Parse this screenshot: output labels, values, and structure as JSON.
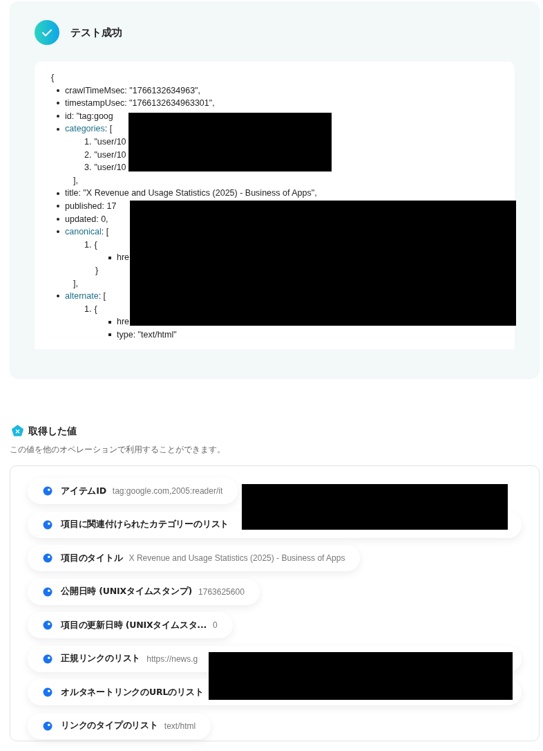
{
  "test_result": {
    "title": "テスト成功",
    "code_view": {
      "open": "{",
      "items": [
        {
          "kind": "field",
          "text": "crawlTimeMsec: \"1766132634963\","
        },
        {
          "kind": "field",
          "text": "timestampUsec: \"1766132634963301\","
        },
        {
          "kind": "field",
          "text": "id: \"tag:goog"
        },
        {
          "kind": "list",
          "key": "categories",
          "after": ": [",
          "close": "],",
          "children": [
            {
              "number": "1.",
              "text": "\"user/10"
            },
            {
              "number": "2.",
              "text": "\"user/10"
            },
            {
              "number": "3.",
              "text": "\"user/10"
            }
          ]
        },
        {
          "kind": "field",
          "text": "title: \"X Revenue and Usage Statistics (2025) - Business of Apps\","
        },
        {
          "kind": "field",
          "text": "published: 17"
        },
        {
          "kind": "field",
          "text": "updated: 0,"
        },
        {
          "kind": "list",
          "key": "canonical",
          "after": ": [",
          "close": "],",
          "children": [
            {
              "number": "1.",
              "text": "{",
              "close": "}",
              "children": [
                {
                  "text": "hre"
                }
              ]
            }
          ]
        },
        {
          "kind": "list",
          "key": "alternate",
          "after": ": [",
          "children": [
            {
              "number": "1.",
              "text": "{",
              "children": [
                {
                  "text": "hre"
                },
                {
                  "text": "type: \"text/html\""
                }
              ]
            }
          ]
        }
      ]
    }
  },
  "values_section": {
    "title": "取得した値",
    "description": "この値を他のオペレーションで利用することができます。",
    "items": [
      {
        "label": "アイテムID",
        "value": "tag:google.com,2005:reader/it",
        "redacted": false
      },
      {
        "label": "項目に関連付けられたカテゴリーのリスト",
        "redacted": true
      },
      {
        "label": "項目のタイトル",
        "value": "X Revenue and Usage Statistics (2025) - Business of Apps",
        "redacted": false
      },
      {
        "label": "公開日時 (UNIXタイムスタンプ)",
        "value": "1763625600",
        "redacted": false
      },
      {
        "label": "項目の更新日時 (UNIXタイムスタ...",
        "value": "0",
        "redacted": false
      },
      {
        "label": "正規リンクのリスト",
        "value": "https://news.g",
        "redacted": true
      },
      {
        "label": "オルタネートリンクのURLのリスト",
        "redacted": true
      },
      {
        "label": "リンクのタイプのリスト",
        "value": "text/html",
        "redacted": false
      }
    ]
  }
}
